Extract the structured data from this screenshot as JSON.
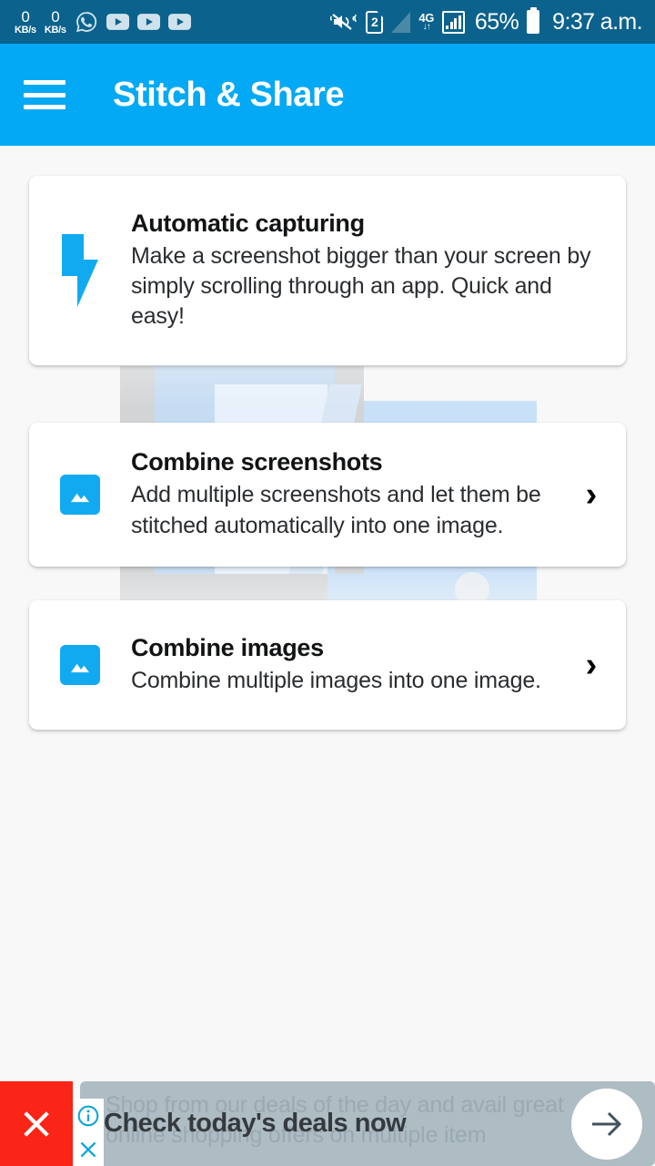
{
  "status_bar": {
    "background_color": "#0b628c",
    "net_speed_1": {
      "value": "0",
      "unit": "KB/s"
    },
    "net_speed_2": {
      "value": "0",
      "unit": "KB/s"
    },
    "notification_icons": [
      "whatsapp-icon",
      "youtube-icon",
      "youtube-icon",
      "youtube-icon"
    ],
    "vibrate_mute_icon": "mute-vibrate-icon",
    "sim_label": "2",
    "network_type": "4G",
    "network_arrows": "↓↑",
    "battery_percent": "65%",
    "time": "9:37 a.m."
  },
  "app_bar": {
    "menu_icon": "hamburger-menu-icon",
    "title": "Stitch & Share",
    "background_color": "#03a9f4"
  },
  "cards": [
    {
      "id": "automatic-capturing",
      "icon": "lightning-bolt-icon",
      "title": "Automatic capturing",
      "description": "Make a screenshot bigger than your screen by simply scrolling through an app. Quick and easy!",
      "has_chevron": false
    },
    {
      "id": "combine-screenshots",
      "icon": "image-icon",
      "title": "Combine screenshots",
      "description": "Add multiple screenshots and let them be stitched automatically into one image.",
      "has_chevron": true,
      "chevron": "›"
    },
    {
      "id": "combine-images",
      "icon": "image-icon",
      "title": "Combine images",
      "description": "Combine multiple images into one image.",
      "has_chevron": true,
      "chevron": "›"
    }
  ],
  "ad_banner": {
    "close_button_icon": "close-x-icon",
    "close_button_color": "#fa2417",
    "info_icon": "info-circle-icon",
    "dismiss_icon": "close-x-icon",
    "background_text": "Shop from our deals of the day and avail great online shopping offers on multiple item",
    "headline": "Check today's deals now",
    "cta_icon": "arrow-right-icon",
    "surface_color": "#aebcc4"
  },
  "theme": {
    "accent": "#03a9f4",
    "page_background": "#f8f8f9",
    "card_background": "#ffffff",
    "title_color": "#111315"
  }
}
